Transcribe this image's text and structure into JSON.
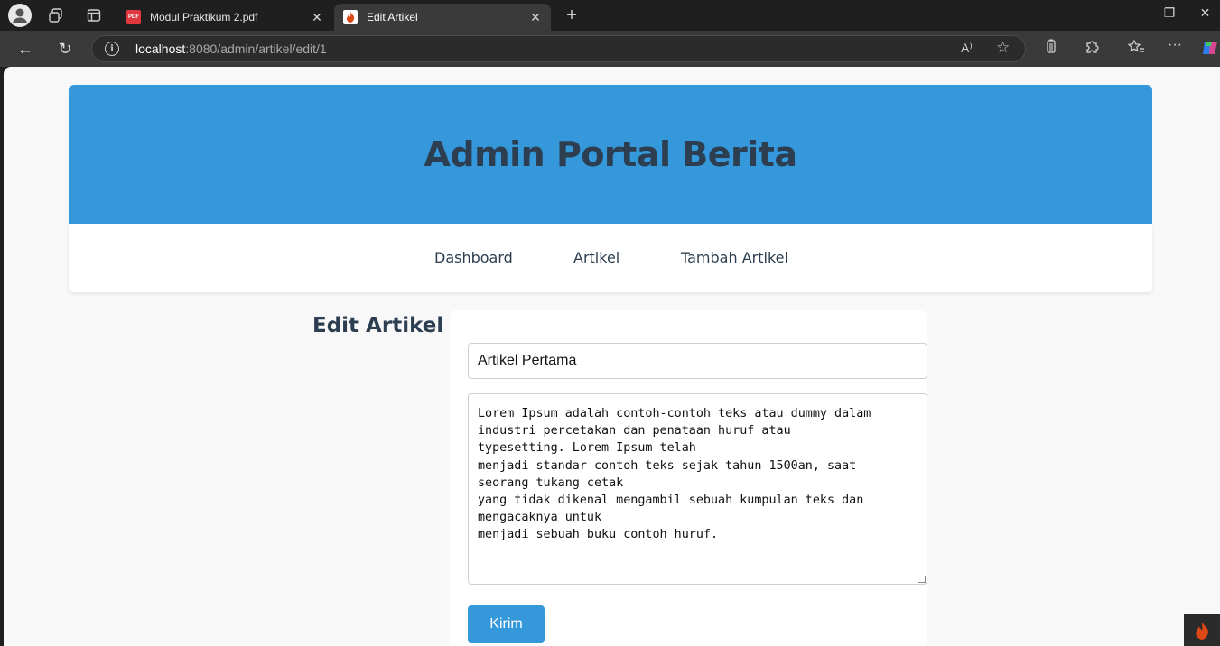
{
  "browser": {
    "tabs": [
      {
        "title": "Modul Praktikum 2.pdf",
        "favicon_color": "#e0383e",
        "favicon_text": "PDF"
      },
      {
        "title": "Edit Artikel",
        "favicon_color": "#ffffff"
      }
    ],
    "url_host": "localhost",
    "url_rest": ":8080/admin/artikel/edit/1",
    "icons": {
      "profile": "profile-avatar-icon",
      "workspaces": "workspaces-icon",
      "tab_actions": "tab-actions-icon",
      "new_tab": "+",
      "back": "←",
      "refresh": "↻",
      "read_aloud": "A⁾",
      "favorite": "☆",
      "minimize": "—",
      "restore": "❐",
      "close": "✕",
      "tab_close": "✕",
      "extensions": "extensions-icon",
      "favorites": "favorites-icon",
      "more": "···"
    }
  },
  "page": {
    "header_title": "Admin Portal Berita",
    "nav": [
      "Dashboard",
      "Artikel",
      "Tambah Artikel"
    ],
    "form_heading": "Edit Artikel",
    "judul_value": "Artikel Pertama",
    "isi_value": "Lorem Ipsum adalah contoh-contoh teks atau dummy dalam\nindustri percetakan dan penataan huruf atau\ntypesetting. Lorem Ipsum telah\nmenjadi standar contoh teks sejak tahun 1500an, saat\nseorang tukang cetak\nyang tidak dikenal mengambil sebuah kumpulan teks dan\nmengacaknya untuk\nmenjadi sebuah buku contoh huruf.",
    "submit_label": "Kirim"
  },
  "colors": {
    "accent": "#3598db",
    "heading": "#2c3e50"
  }
}
